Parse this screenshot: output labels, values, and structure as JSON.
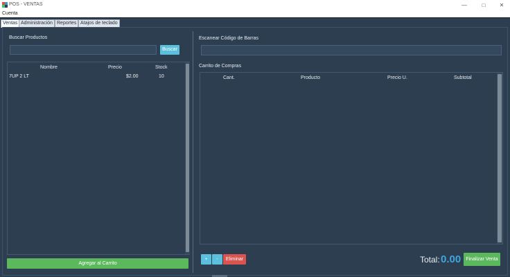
{
  "window": {
    "title": "POS - VENTAS",
    "controls": {
      "minimize": "—",
      "maximize": "□",
      "close": "✕"
    }
  },
  "menu": {
    "items": [
      "Cuenta"
    ]
  },
  "tabs": [
    {
      "label": "Ventas",
      "active": true
    },
    {
      "label": "Administración",
      "active": false
    },
    {
      "label": "Reportes",
      "active": false
    },
    {
      "label": "Atajos de teclado",
      "active": false
    }
  ],
  "left_panel": {
    "group_title": "Buscar Productos",
    "search": {
      "value": "",
      "placeholder": ""
    },
    "search_button": "Buscar",
    "table": {
      "columns": [
        "Nombre",
        "Precio",
        "Stock"
      ],
      "rows": [
        {
          "nombre": "7UP 2 LT",
          "precio": "$2.00",
          "stock": "10"
        }
      ]
    },
    "add_button": "Agregar al Carrito"
  },
  "right_panel": {
    "barcode_title": "Escanear Código de Barras",
    "barcode_input": {
      "value": "",
      "placeholder": ""
    },
    "cart_title": "Carrito de Compras",
    "cart_columns": [
      "Cant.",
      "Producto",
      "Precio U.",
      "Subtotal"
    ],
    "cart_rows": [],
    "qty_plus_button": "+",
    "qty_minus_button": "-",
    "remove_button": "Eliminar",
    "total_label": "Total:",
    "total_value": "0.00",
    "finish_button": "Finalizar Venta"
  },
  "colors": {
    "background": "#2c3e50",
    "accent_blue": "#3fa7e0",
    "button_blue": "#5bc0de",
    "button_green": "#5cb85c",
    "button_red": "#d9534f"
  },
  "icons": {
    "app": "pos-app-icon"
  }
}
